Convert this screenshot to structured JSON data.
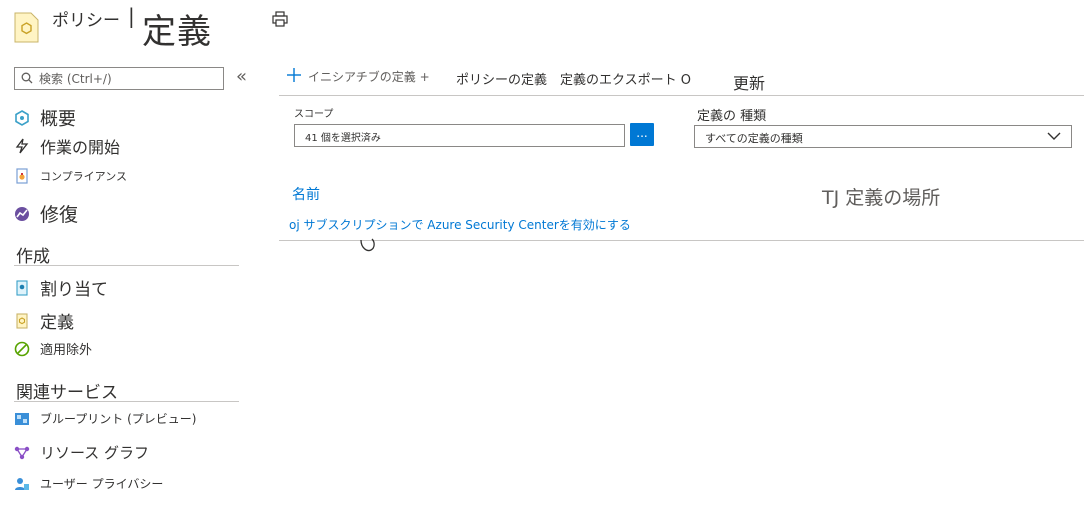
{
  "header": {
    "prefix": "ポリシー",
    "separator": "|",
    "title": "定義"
  },
  "search": {
    "placeholder": "検索 (Ctrl+/)"
  },
  "collapse_glyph": "«",
  "sidebar": {
    "items_top": [
      {
        "label": "概要",
        "icon": "overview-icon"
      },
      {
        "label": "作業の開始",
        "icon": "lightning-icon"
      },
      {
        "label": "コンプライアンス",
        "icon": "compliance-icon"
      },
      {
        "label": "修復",
        "icon": "remediation-icon"
      }
    ],
    "section_create": {
      "heading": "作成",
      "items": [
        {
          "label": "割り当て",
          "icon": "assignment-icon"
        },
        {
          "label": "定義",
          "icon": "definition-icon"
        },
        {
          "label": "適用除外",
          "icon": "exemption-icon"
        }
      ]
    },
    "section_related": {
      "heading": "関連サービス",
      "items": [
        {
          "label": "ブループリント (プレビュー)",
          "icon": "blueprint-icon"
        },
        {
          "label": "リソース グラフ",
          "icon": "resource-graph-icon"
        },
        {
          "label": "ユーザー プライバシー",
          "icon": "user-privacy-icon"
        }
      ]
    }
  },
  "toolbar": {
    "initiative_def": "イニシアチブの定義 +",
    "policy_def": "ポリシーの定義",
    "export": "定義のエクスポート O",
    "refresh": "更新"
  },
  "filters": {
    "scope_label": "スコープ",
    "scope_value": "41 個を選択済み",
    "scope_button": "...",
    "type_label": "定義の 種類",
    "type_value": "すべての定義の種類"
  },
  "table": {
    "col_name": "名前",
    "col_location": "TJ 定義の場所",
    "rows": [
      {
        "name": "oj サブスクリプションで Azure Security Centerを有効にする"
      }
    ]
  },
  "colors": {
    "accent": "#0078d4",
    "text": "#323130",
    "border": "#c8c6c4"
  }
}
